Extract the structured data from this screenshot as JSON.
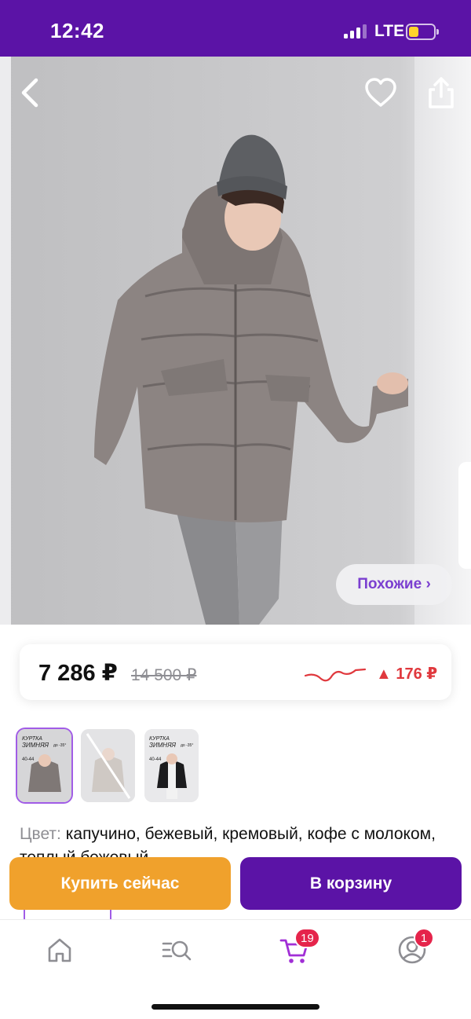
{
  "status_bar": {
    "time": "12:42",
    "network": "LTE",
    "signal_bars": 3,
    "battery_level": 0.3,
    "background_color": "#5b13a6",
    "battery_color": "#ffd42a"
  },
  "hero": {
    "image_description_icon": "product-photo-jacket",
    "back_icon": "chevron-left-icon",
    "favorite_icon": "heart-outline-icon",
    "share_icon": "share-icon",
    "similar_label": "Похожие ›"
  },
  "price": {
    "current": "7 286 ₽",
    "old": "14 500 ₽",
    "change": "▲ 176 ₽",
    "change_color": "#e0393e",
    "trend_icon": "price-trend-sparkline-icon"
  },
  "thumbnails": [
    {
      "selected": true,
      "badge_title": "КУРТКА",
      "badge_subtitle": "ЗИМНЯЯ",
      "temp": "до -35°",
      "sizes": "40-44"
    },
    {
      "selected": false
    },
    {
      "selected": false,
      "badge_title": "КУРТКА",
      "badge_subtitle": "ЗИМНЯЯ",
      "temp": "до -35°",
      "sizes": "40-44"
    }
  ],
  "color_info": {
    "label": "Цвет:",
    "value": "капучино, бежевый, кремовый, кофе с молоком, теплый бежевый"
  },
  "actions": {
    "buy_now": "Купить сейчас",
    "add_to_cart": "В корзину",
    "buy_color": "#f0a12c",
    "cart_color": "#5b13a6"
  },
  "tabbar": {
    "items": [
      {
        "icon": "home-icon",
        "badge": null
      },
      {
        "icon": "catalog-search-icon",
        "badge": null
      },
      {
        "icon": "cart-icon",
        "badge": "19",
        "active": true
      },
      {
        "icon": "profile-icon",
        "badge": "1"
      }
    ],
    "accent_color": "#a12fd6"
  }
}
